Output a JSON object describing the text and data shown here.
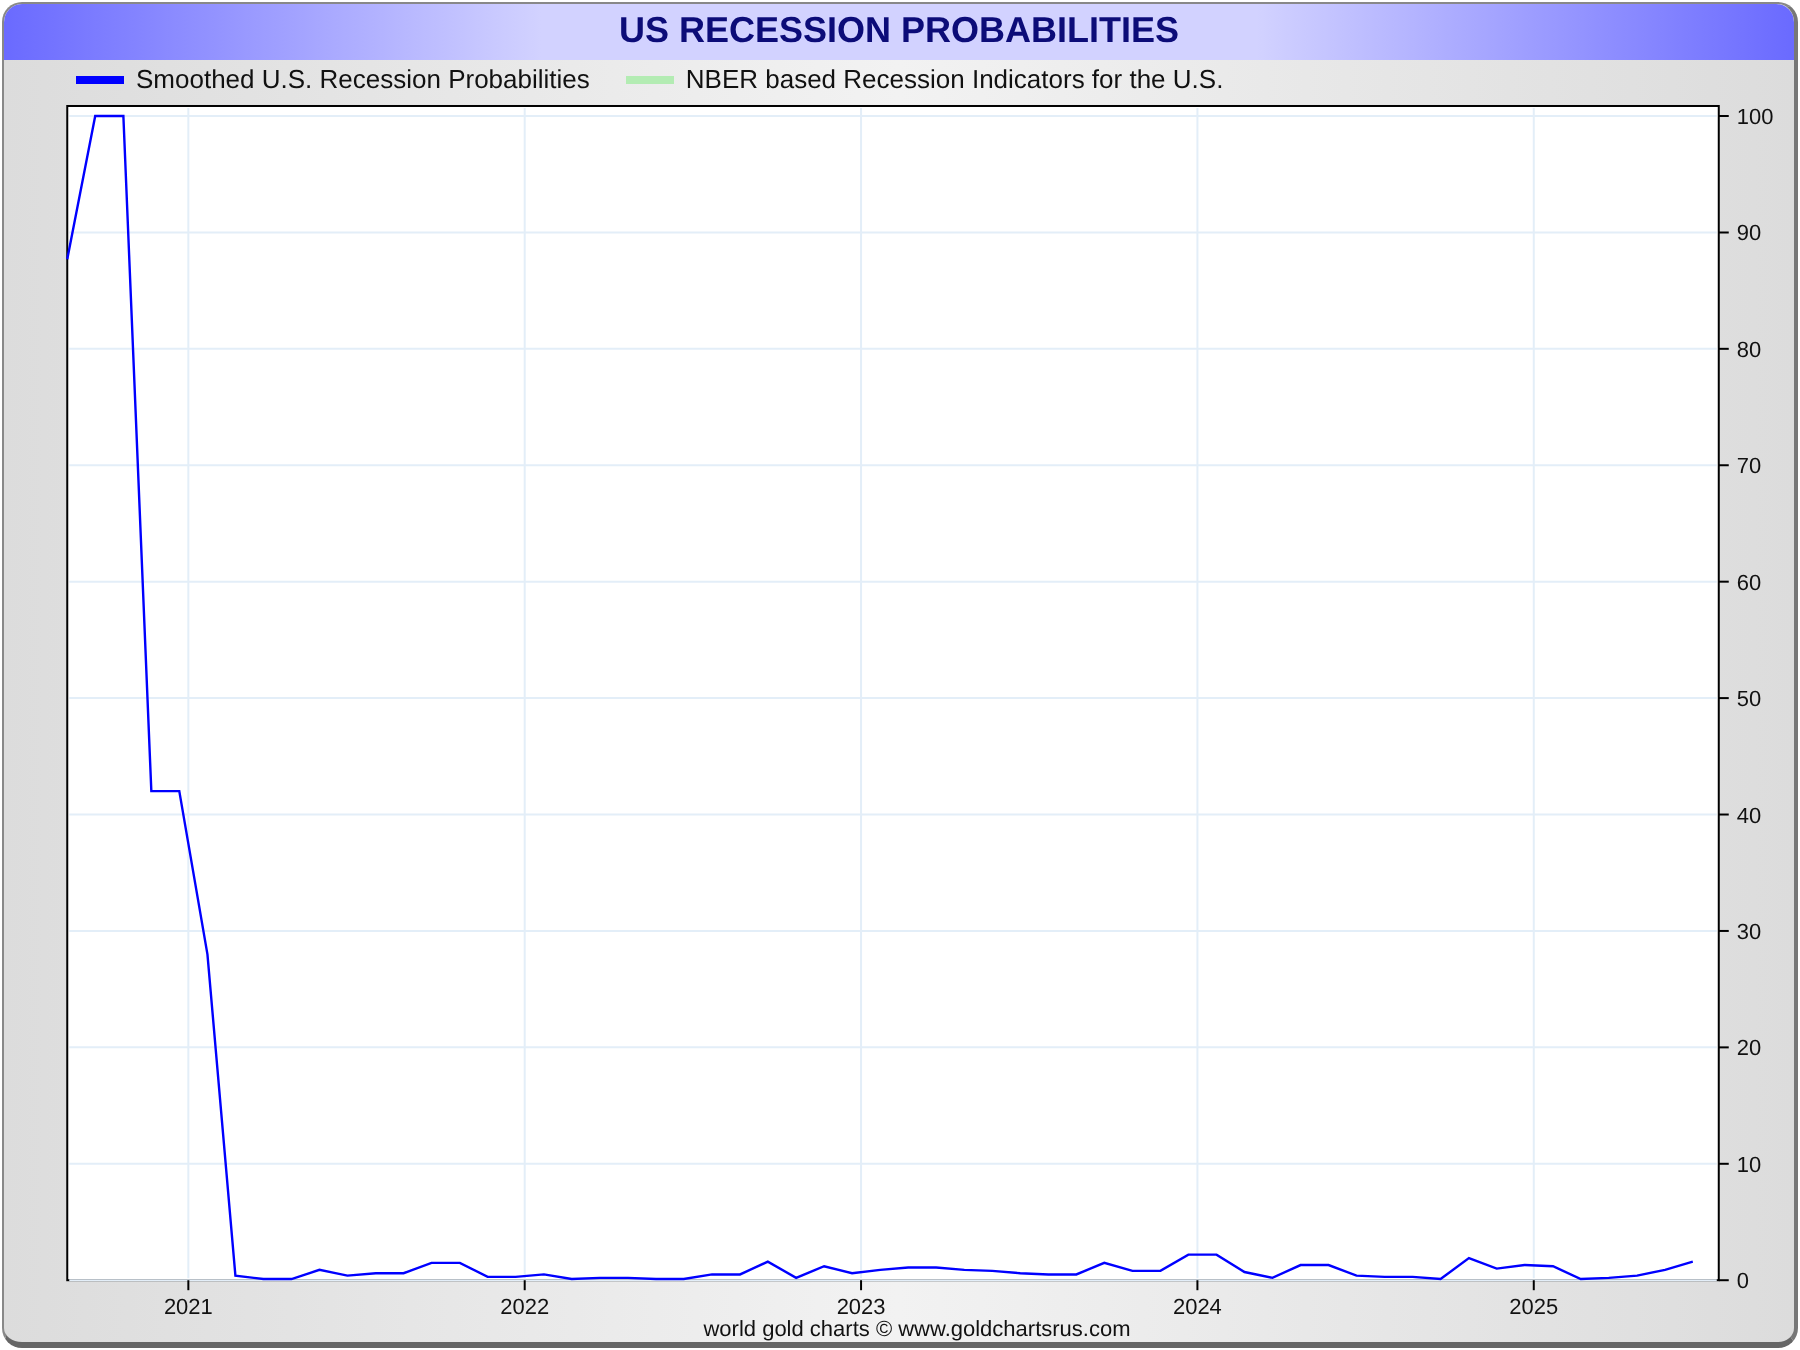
{
  "title": "US RECESSION PROBABILITIES",
  "legend": [
    {
      "label": "NBER based Recession Indicators for the U.S.",
      "color": "#b3ecb3"
    }
  ],
  "chart_data": {
    "type": "line",
    "grid": true,
    "xlim": [
      2020.64,
      2025.55
    ],
    "ylim": [
      0,
      100
    ],
    "xticks": [
      {
        "value": 2021,
        "label": "2021"
      },
      {
        "value": 2022,
        "label": "2022"
      },
      {
        "value": 2023,
        "label": "2023"
      },
      {
        "value": 2024,
        "label": "2024"
      },
      {
        "value": 2025,
        "label": "2025"
      }
    ],
    "yticks": [
      0,
      10,
      20,
      30,
      40,
      50,
      60,
      70,
      80,
      90,
      100
    ],
    "series": [
      {
        "name": "Smoothed U.S. Recession Probabilities",
        "color": "#0000ff",
        "x": [
          2020.64,
          2020.723,
          2020.807,
          2020.89,
          2020.973,
          2021.057,
          2021.14,
          2021.223,
          2021.307,
          2021.39,
          2021.473,
          2021.557,
          2021.64,
          2021.723,
          2021.807,
          2021.89,
          2021.973,
          2022.057,
          2022.14,
          2022.223,
          2022.307,
          2022.39,
          2022.473,
          2022.557,
          2022.64,
          2022.723,
          2022.807,
          2022.89,
          2022.973,
          2023.057,
          2023.14,
          2023.223,
          2023.307,
          2023.39,
          2023.473,
          2023.557,
          2023.64,
          2023.723,
          2023.807,
          2023.89,
          2023.973,
          2024.057,
          2024.14,
          2024.223,
          2024.307,
          2024.39,
          2024.473,
          2024.557,
          2024.64,
          2024.723,
          2024.807,
          2024.89,
          2024.973,
          2025.057,
          2025.14,
          2025.223,
          2025.307,
          2025.39,
          2025.473
        ],
        "values": [
          87.7,
          100,
          100,
          42,
          42,
          28,
          0.4,
          0.1,
          0.1,
          0.9,
          0.4,
          0.6,
          0.6,
          1.5,
          1.5,
          0.3,
          0.3,
          0.5,
          0.1,
          0.2,
          0.2,
          0.1,
          0.1,
          0.5,
          0.5,
          1.6,
          0.2,
          1.2,
          0.6,
          0.9,
          1.1,
          1.1,
          0.9,
          0.8,
          0.6,
          0.5,
          0.5,
          1.5,
          0.8,
          0.8,
          2.2,
          2.2,
          0.7,
          0.2,
          1.3,
          1.3,
          0.4,
          0.3,
          0.3,
          0.1,
          1.9,
          1.0,
          1.3,
          1.2,
          0.1,
          0.2,
          0.4,
          0.9,
          1.6
        ]
      }
    ]
  },
  "footer": "world gold charts © www.goldchartsrus.com"
}
